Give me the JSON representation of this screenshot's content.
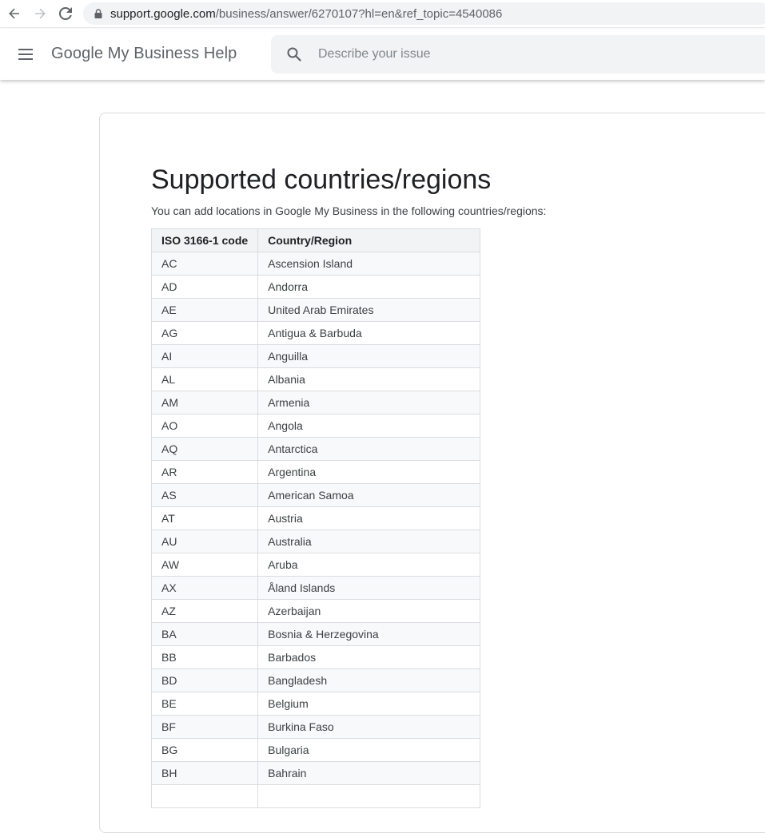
{
  "browser": {
    "url_host": "support.google.com",
    "url_path": "/business/answer/6270107?hl=en&ref_topic=4540086"
  },
  "header": {
    "title": "Google My Business Help",
    "search_placeholder": "Describe your issue"
  },
  "article": {
    "title": "Supported countries/regions",
    "intro": "You can add locations in Google My Business in the following countries/regions:",
    "table": {
      "headers": [
        "ISO 3166-1 code",
        "Country/Region"
      ],
      "rows": [
        [
          "AC",
          "Ascension Island"
        ],
        [
          "AD",
          "Andorra"
        ],
        [
          "AE",
          "United Arab Emirates"
        ],
        [
          "AG",
          "Antigua & Barbuda"
        ],
        [
          "AI",
          "Anguilla"
        ],
        [
          "AL",
          "Albania"
        ],
        [
          "AM",
          "Armenia"
        ],
        [
          "AO",
          "Angola"
        ],
        [
          "AQ",
          "Antarctica"
        ],
        [
          "AR",
          "Argentina"
        ],
        [
          "AS",
          "American Samoa"
        ],
        [
          "AT",
          "Austria"
        ],
        [
          "AU",
          "Australia"
        ],
        [
          "AW",
          "Aruba"
        ],
        [
          "AX",
          "Åland Islands"
        ],
        [
          "AZ",
          "Azerbaijan"
        ],
        [
          "BA",
          "Bosnia & Herzegovina"
        ],
        [
          "BB",
          "Barbados"
        ],
        [
          "BD",
          "Bangladesh"
        ],
        [
          "BE",
          "Belgium"
        ],
        [
          "BF",
          "Burkina Faso"
        ],
        [
          "BG",
          "Bulgaria"
        ],
        [
          "BH",
          "Bahrain"
        ],
        [
          "",
          ""
        ]
      ]
    }
  }
}
